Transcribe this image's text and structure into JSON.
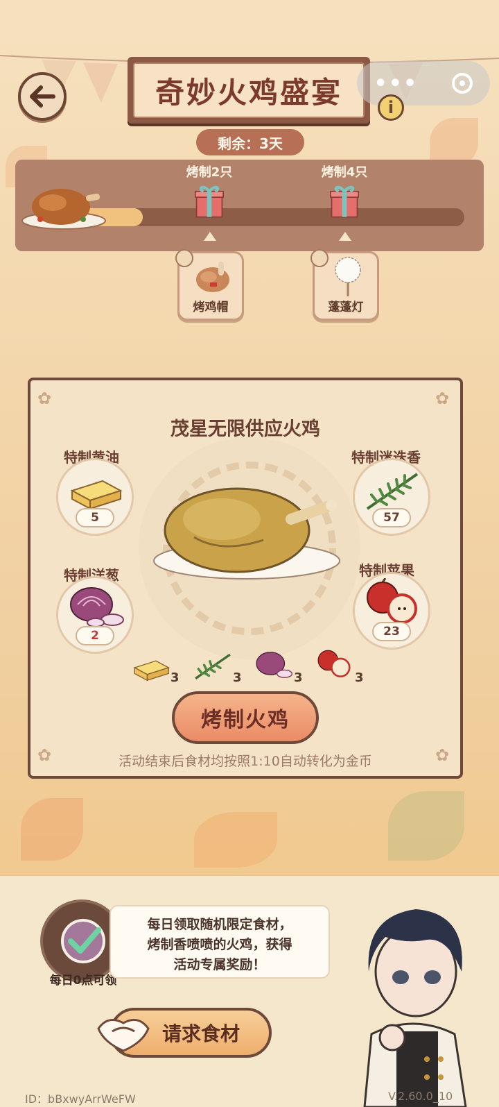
{
  "header": {
    "title": "奇妙火鸡盛宴",
    "remaining": "剩余：3天",
    "menu_icon": "more-dots-icon",
    "close_icon": "target-circle-icon",
    "info_icon": "i"
  },
  "progress": {
    "fraction": 0.2,
    "milestones": [
      {
        "label": "烤制2只",
        "reward": "烤鸡帽"
      },
      {
        "label": "烤制4只",
        "reward": "蓬蓬灯"
      }
    ]
  },
  "panel": {
    "title": "茂星无限供应火鸡",
    "ingredients": [
      {
        "name": "特制黄油",
        "count": "5"
      },
      {
        "name": "特制迷迭香",
        "count": "57"
      },
      {
        "name": "特制洋葱",
        "count": "2"
      },
      {
        "name": "特制苹果",
        "count": "23"
      }
    ],
    "requirements": [
      "3",
      "3",
      "3",
      "3"
    ],
    "roast_button": "烤制火鸡",
    "note": "活动结束后食材均按照1:10自动转化为金币"
  },
  "daily": {
    "label": "每日0点可领",
    "message_lines": [
      "每日领取随机限定食材，",
      "烤制香喷喷的火鸡，获得",
      "活动专属奖励！"
    ]
  },
  "request_button": "请求食材",
  "footer": {
    "id": "ID：bBxwyArrWeFW",
    "version": "V.2.60.0_10"
  }
}
